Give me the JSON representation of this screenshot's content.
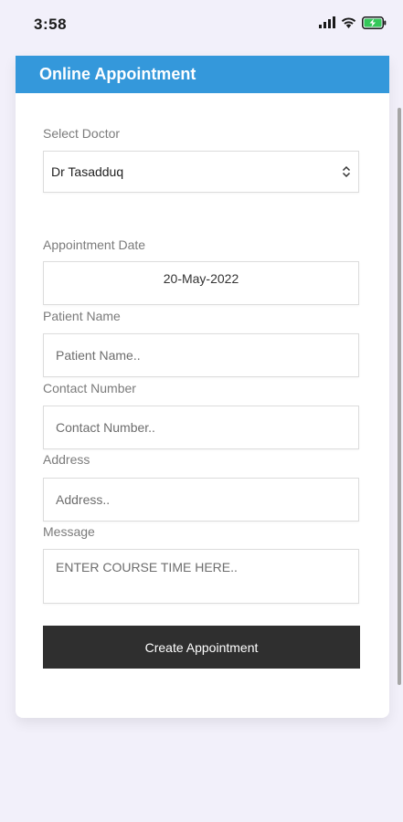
{
  "status": {
    "time": "3:58"
  },
  "header": {
    "title": "Online Appointment"
  },
  "form": {
    "doctor_label": "Select Doctor",
    "doctor_value": "Dr Tasadduq",
    "date_label": "Appointment Date",
    "date_value": "20-May-2022",
    "patient_label": "Patient Name",
    "patient_placeholder": "Patient Name..",
    "contact_label": "Contact Number",
    "contact_placeholder": "Contact Number..",
    "address_label": "Address",
    "address_placeholder": "Address..",
    "message_label": "Message",
    "message_placeholder": "ENTER COURSE TIME HERE..",
    "submit_label": "Create Appointment"
  },
  "colors": {
    "header": "#3498db",
    "button": "#2f2f2f",
    "background": "#f2f0fa",
    "battery": "#34c759"
  },
  "icons": [
    "signal-icon",
    "wifi-icon",
    "battery-charging-icon",
    "chevron-updown-icon"
  ]
}
